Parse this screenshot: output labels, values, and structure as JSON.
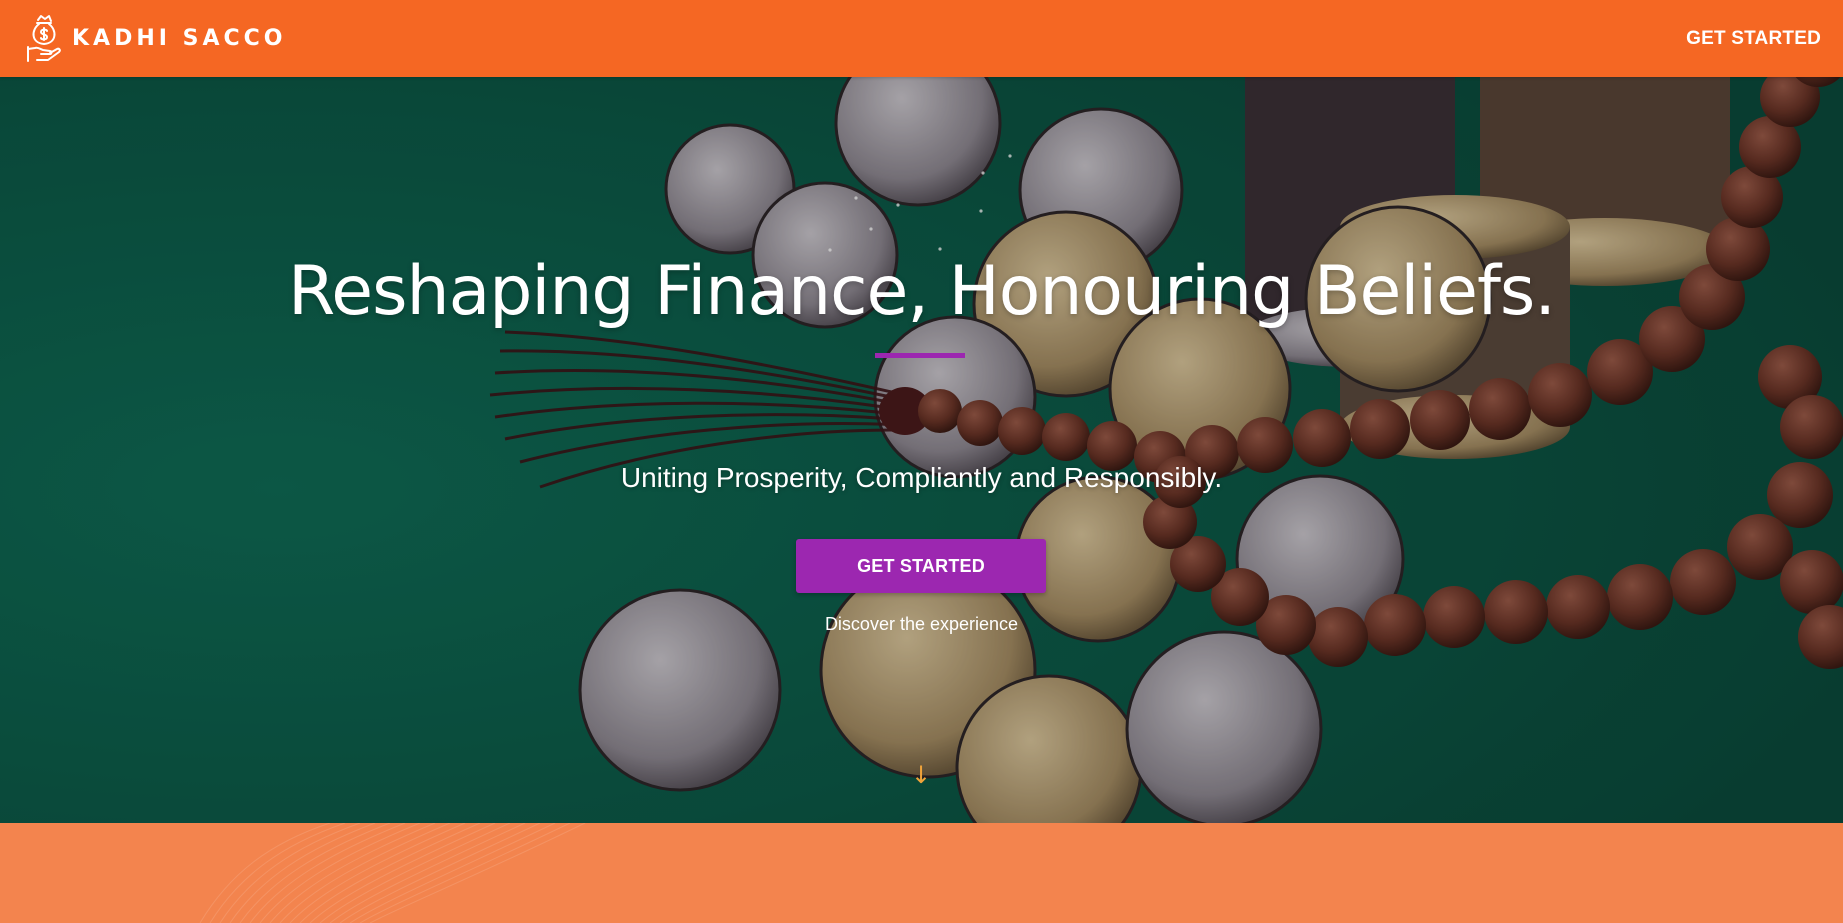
{
  "brand": {
    "name": "KADHI SACCO",
    "logo_icon": "hand-holding-money-bag-icon"
  },
  "nav": {
    "cta_label": "GET STARTED"
  },
  "hero": {
    "title": "Reshaping Finance, Honouring Beliefs.",
    "subtitle": "Uniting Prosperity, Compliantly and Responsibly.",
    "button_label": "GET STARTED",
    "caption": "Discover the experience",
    "scroll_icon": "arrow-down-icon",
    "scroll_glyph": "↓",
    "background_image": "coins-and-prayer-beads-on-green-cloth"
  },
  "colors": {
    "navbar": "#f56723",
    "accent_purple": "#9c27b0",
    "hero_background": "#0d5a48",
    "scroll_arrow": "#f0a33a",
    "next_section": "#f3844e"
  }
}
